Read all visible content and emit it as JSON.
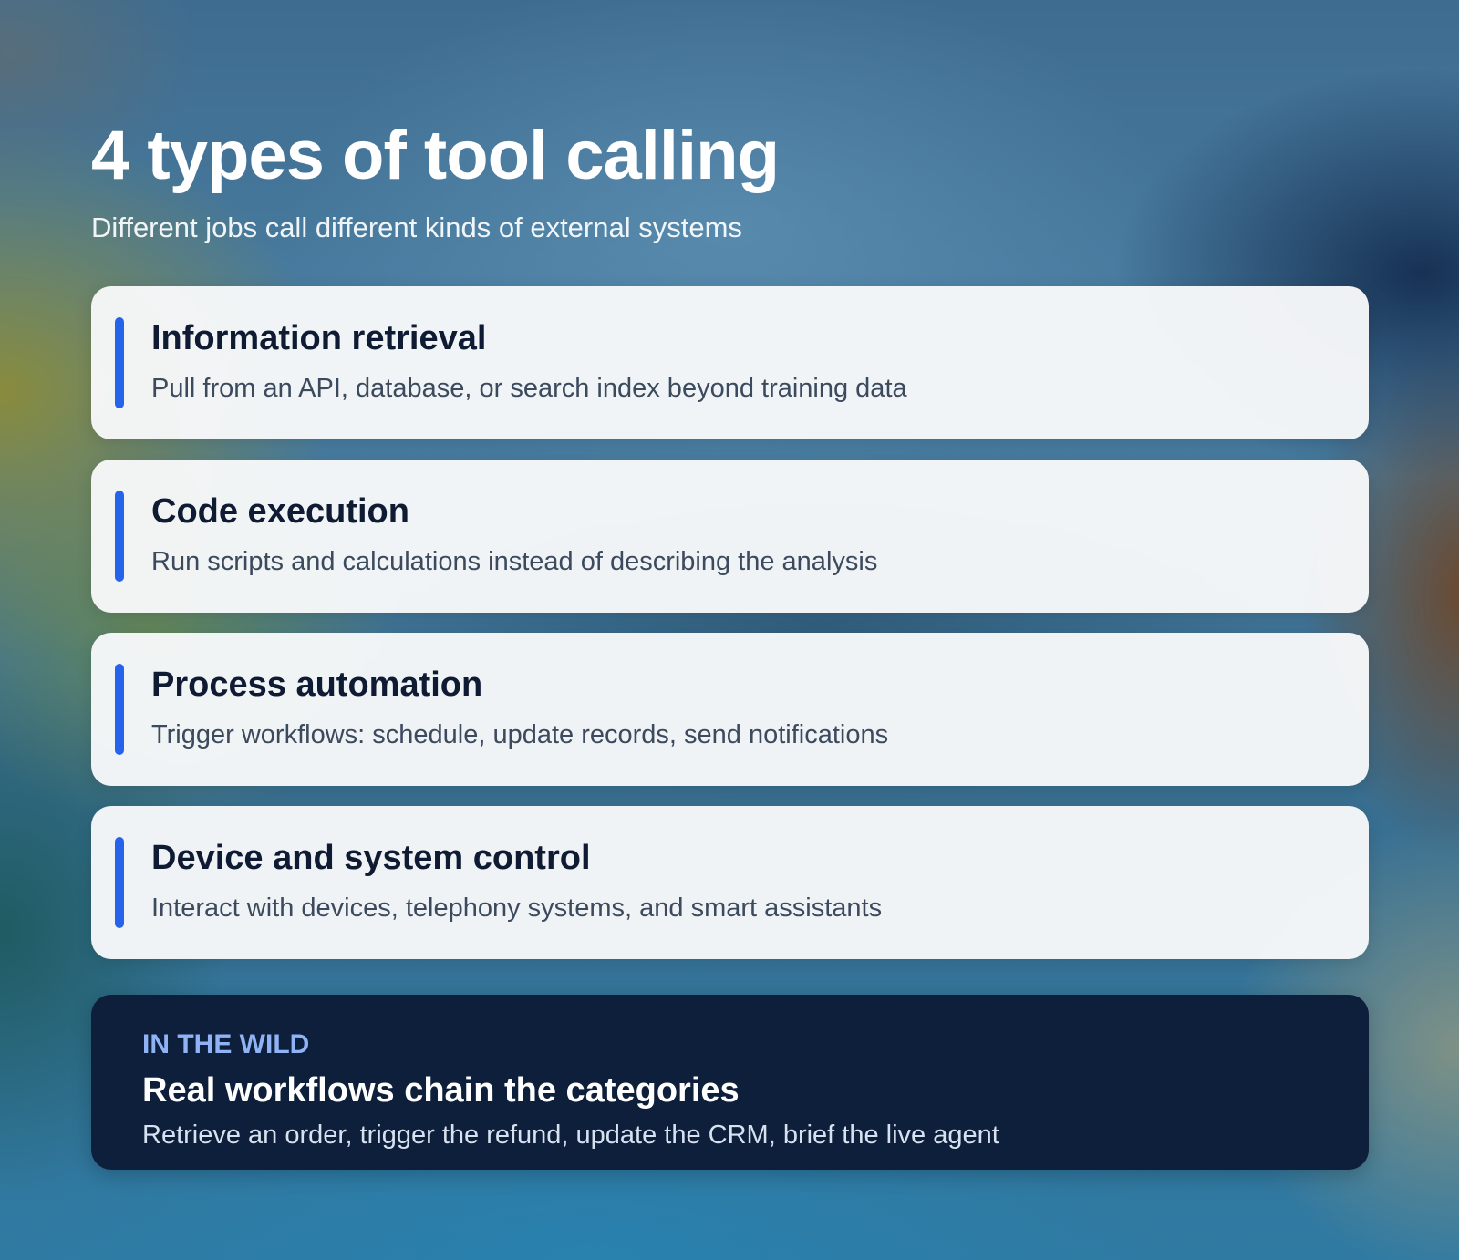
{
  "header": {
    "title": "4 types of tool calling",
    "subtitle": "Different jobs call different kinds of external systems"
  },
  "cards": [
    {
      "title": "Information retrieval",
      "description": "Pull from an API, database, or search index beyond training data"
    },
    {
      "title": "Code execution",
      "description": "Run scripts and calculations instead of describing the analysis"
    },
    {
      "title": "Process automation",
      "description": "Trigger workflows: schedule, update records, send notifications"
    },
    {
      "title": "Device and system control",
      "description": "Interact with devices, telephony systems, and smart assistants"
    }
  ],
  "callout": {
    "label": "IN THE WILD",
    "title": "Real workflows chain the categories",
    "description": "Retrieve an order, trigger the refund, update the CRM, brief the live agent"
  },
  "colors": {
    "accent": "#2563eb",
    "callout_background": "#0d1f3a",
    "callout_label": "#8fb3f5",
    "card_background": "#f8f9fa",
    "heading_text": "#0f1b33"
  }
}
